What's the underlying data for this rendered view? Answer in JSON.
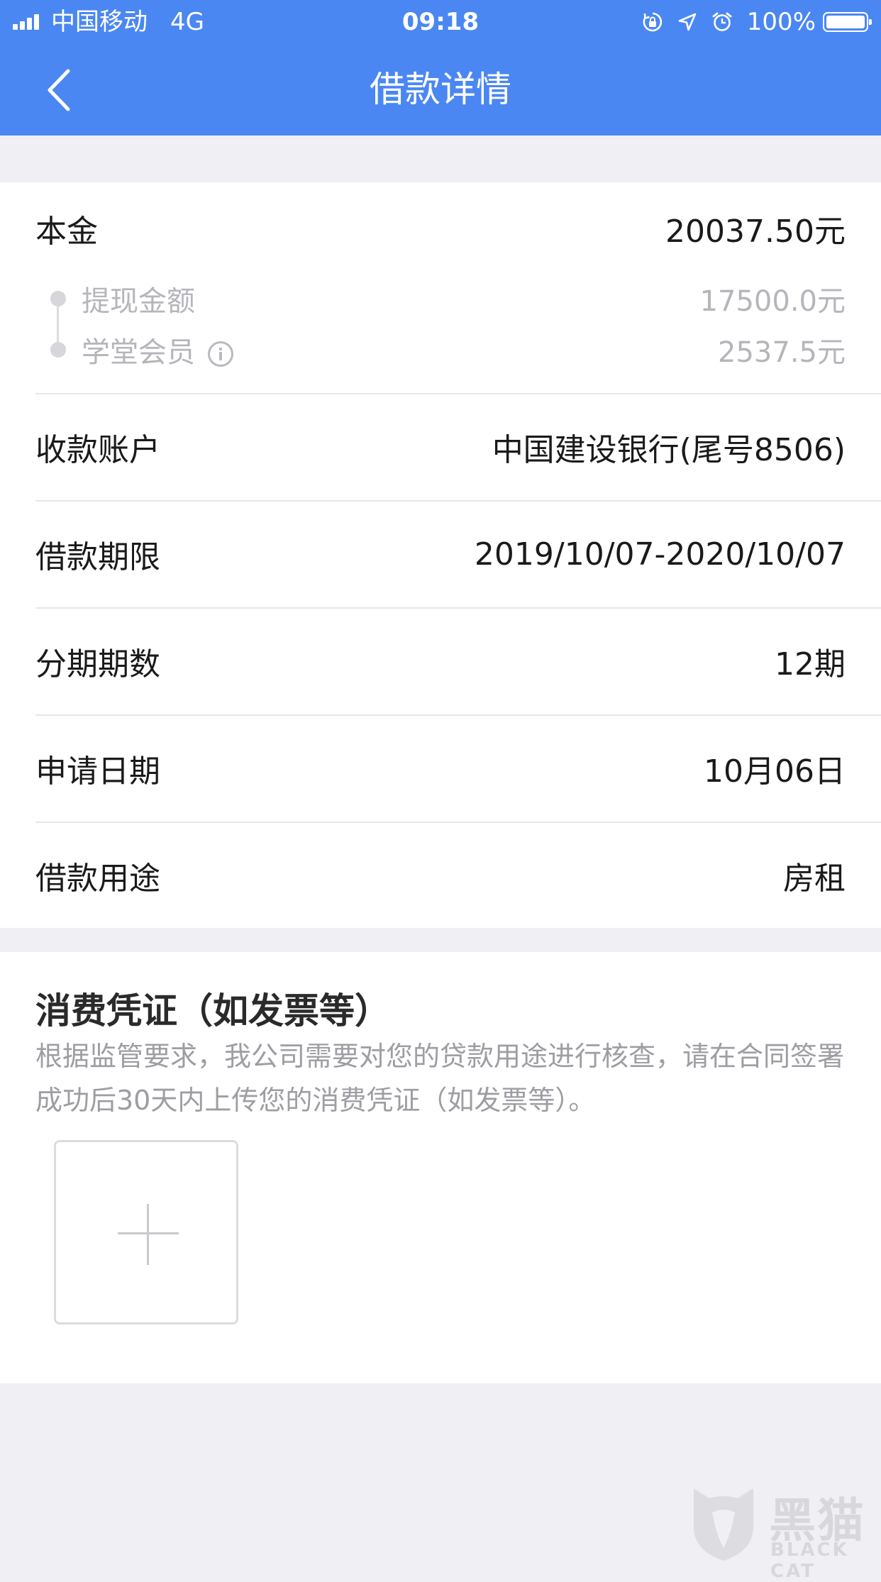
{
  "status_bar": {
    "carrier": "中国移动",
    "network": "4G",
    "time": "09:18",
    "battery": "100%",
    "icons": [
      "orientation-lock-icon",
      "location-icon",
      "alarm-icon",
      "battery-icon"
    ]
  },
  "nav": {
    "title": "借款详情",
    "back_icon": "chevron-left-icon"
  },
  "principal": {
    "label": "本金",
    "value": "20037.50元",
    "items": [
      {
        "label": "提现金额",
        "value": "17500.0元"
      },
      {
        "label": "学堂会员",
        "value": "2537.5元",
        "icon": "info-icon"
      }
    ]
  },
  "details": [
    {
      "label": "收款账户",
      "value": "中国建设银行(尾号8506)"
    },
    {
      "label": "借款期限",
      "value": "2019/10/07-2020/10/07"
    },
    {
      "label": "分期期数",
      "value": "12期"
    },
    {
      "label": "申请日期",
      "value": "10月06日"
    },
    {
      "label": "借款用途",
      "value": "房租"
    }
  ],
  "voucher": {
    "title": "消费凭证（如发票等）",
    "description": "根据监管要求，我公司需要对您的贷款用途进行核查，请在合同签署成功后30天内上传您的消费凭证（如发票等）。",
    "upload_icon": "plus-icon"
  },
  "watermark": {
    "cn": "黑猫",
    "en": "BLACK CAT"
  },
  "colors": {
    "nav_background": "#4a87f2",
    "page_background": "#efeff4",
    "secondary_text": "#b5b5bb"
  }
}
